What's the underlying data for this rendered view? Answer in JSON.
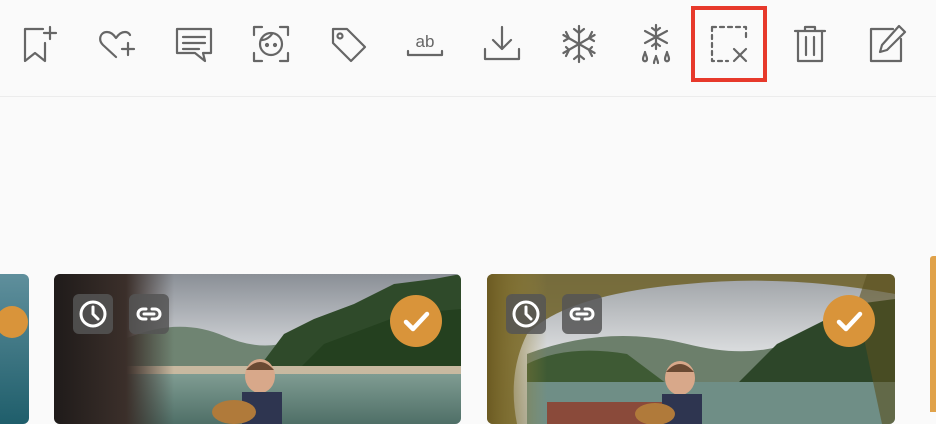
{
  "toolbar": {
    "tools": [
      {
        "name": "add-to-album-icon"
      },
      {
        "name": "favorite-add-icon"
      },
      {
        "name": "comment-icon"
      },
      {
        "name": "face-recognition-icon"
      },
      {
        "name": "tag-icon"
      },
      {
        "name": "rename-icon",
        "label": "ab"
      },
      {
        "name": "download-icon"
      },
      {
        "name": "freeze-icon"
      },
      {
        "name": "unfreeze-icon"
      },
      {
        "name": "deselect-icon",
        "highlighted": true
      },
      {
        "name": "delete-icon"
      },
      {
        "name": "edit-icon"
      }
    ],
    "highlight_color": "#e7392b",
    "icon_color": "#666666"
  },
  "cards": [
    {
      "name": "photo-card-left-partial"
    },
    {
      "name": "photo-card-1",
      "selected": true,
      "badges": [
        "clock-icon",
        "link-icon"
      ]
    },
    {
      "name": "photo-card-2",
      "selected": true,
      "badges": [
        "clock-icon",
        "link-icon"
      ]
    }
  ],
  "colors": {
    "accent": "#d9943a",
    "badge_bg": "#555555"
  }
}
